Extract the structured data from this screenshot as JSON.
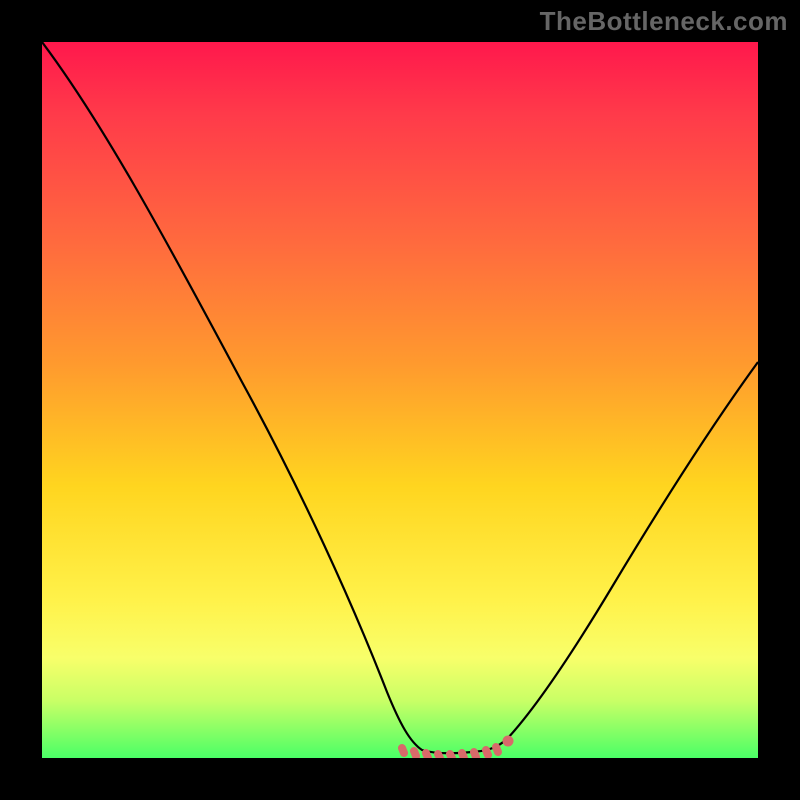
{
  "watermark": "TheBottleneck.com",
  "chart_data": {
    "type": "line",
    "title": "",
    "xlabel": "",
    "ylabel": "",
    "xlim": [
      0,
      100
    ],
    "ylim": [
      0,
      100
    ],
    "grid": false,
    "legend": false,
    "series": [
      {
        "name": "main-curve",
        "color": "#000000",
        "x": [
          0,
          5,
          10,
          15,
          20,
          25,
          30,
          35,
          40,
          45,
          48,
          50,
          53,
          56,
          60,
          63,
          66,
          70,
          75,
          80,
          85,
          90,
          95,
          100
        ],
        "y": [
          100,
          91,
          81,
          71,
          61,
          51,
          41,
          31,
          21,
          11,
          4,
          1,
          0,
          0,
          0,
          1,
          3,
          8,
          16,
          25,
          34,
          43,
          52,
          60
        ]
      },
      {
        "name": "bottom-marker-band",
        "color": "#e06a6a",
        "x": [
          50,
          51.5,
          53,
          54.5,
          56,
          57.5,
          59,
          60,
          61.5,
          63
        ],
        "y": [
          1.2,
          0.8,
          0.5,
          0.4,
          0.4,
          0.5,
          0.7,
          0.9,
          1.4,
          2.2
        ]
      }
    ],
    "gradient_stops": [
      {
        "pct": 0,
        "color": "#ff184c"
      },
      {
        "pct": 10,
        "color": "#ff3a4a"
      },
      {
        "pct": 28,
        "color": "#ff6a3e"
      },
      {
        "pct": 45,
        "color": "#ff9a2e"
      },
      {
        "pct": 62,
        "color": "#ffd51f"
      },
      {
        "pct": 78,
        "color": "#fff24a"
      },
      {
        "pct": 86,
        "color": "#f8ff6a"
      },
      {
        "pct": 92,
        "color": "#c9ff66"
      },
      {
        "pct": 100,
        "color": "#4aff66"
      }
    ]
  }
}
